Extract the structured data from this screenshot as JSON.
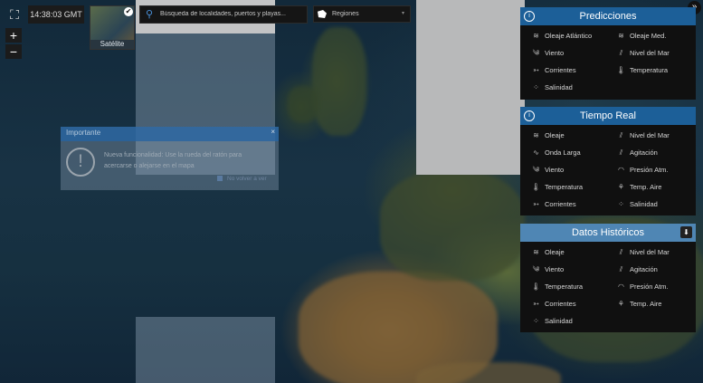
{
  "top_bar": {
    "fullscreen_icon": "fullscreen-icon",
    "clock": "14:38:03 GMT",
    "zoom_in": "+",
    "zoom_out": "−",
    "layer_thumbnail_label": "Satélite",
    "search_placeholder": "Búsqueda de localidades, puertos y playas...",
    "regions_label": "Regiones",
    "collapse_icon": "»"
  },
  "dialog": {
    "title": "Importante",
    "close": "×",
    "message": "Nueva funcionalidad: Use la rueda del ratón para acercarse o alejarse en el mapa",
    "checkbox_label": "No volver a ver"
  },
  "panels": [
    {
      "title": "Predicciones",
      "items": [
        {
          "label": "Oleaje Atlántico",
          "icon": "wave-icon"
        },
        {
          "label": "Oleaje Med.",
          "icon": "wave-icon"
        },
        {
          "label": "Viento",
          "icon": "wind-icon"
        },
        {
          "label": "Nivel del Mar",
          "icon": "sea-level-icon"
        },
        {
          "label": "Corrientes",
          "icon": "current-icon"
        },
        {
          "label": "Temperatura",
          "icon": "thermometer-icon"
        },
        {
          "label": "Salinidad",
          "icon": "salinity-icon"
        }
      ]
    },
    {
      "title": "Tiempo Real",
      "items": [
        {
          "label": "Oleaje",
          "icon": "wave-icon"
        },
        {
          "label": "Nivel del Mar",
          "icon": "sea-level-icon"
        },
        {
          "label": "Onda Larga",
          "icon": "long-wave-icon"
        },
        {
          "label": "Agitación",
          "icon": "agitation-icon"
        },
        {
          "label": "Viento",
          "icon": "wind-icon"
        },
        {
          "label": "Presión Atm.",
          "icon": "pressure-icon"
        },
        {
          "label": "Temperatura",
          "icon": "thermometer-icon"
        },
        {
          "label": "Temp. Aire",
          "icon": "air-temp-icon"
        },
        {
          "label": "Corrientes",
          "icon": "current-icon"
        },
        {
          "label": "Salinidad",
          "icon": "salinity-icon"
        }
      ]
    },
    {
      "title": "Datos Históricos",
      "items": [
        {
          "label": "Oleaje",
          "icon": "wave-icon"
        },
        {
          "label": "Nivel del Mar",
          "icon": "sea-level-icon"
        },
        {
          "label": "Viento",
          "icon": "wind-icon"
        },
        {
          "label": "Agitación",
          "icon": "agitation-icon"
        },
        {
          "label": "Temperatura",
          "icon": "thermometer-icon"
        },
        {
          "label": "Presión Atm.",
          "icon": "pressure-icon"
        },
        {
          "label": "Corrientes",
          "icon": "current-icon"
        },
        {
          "label": "Temp. Aire",
          "icon": "air-temp-icon"
        },
        {
          "label": "Salinidad",
          "icon": "salinity-icon"
        }
      ]
    }
  ]
}
